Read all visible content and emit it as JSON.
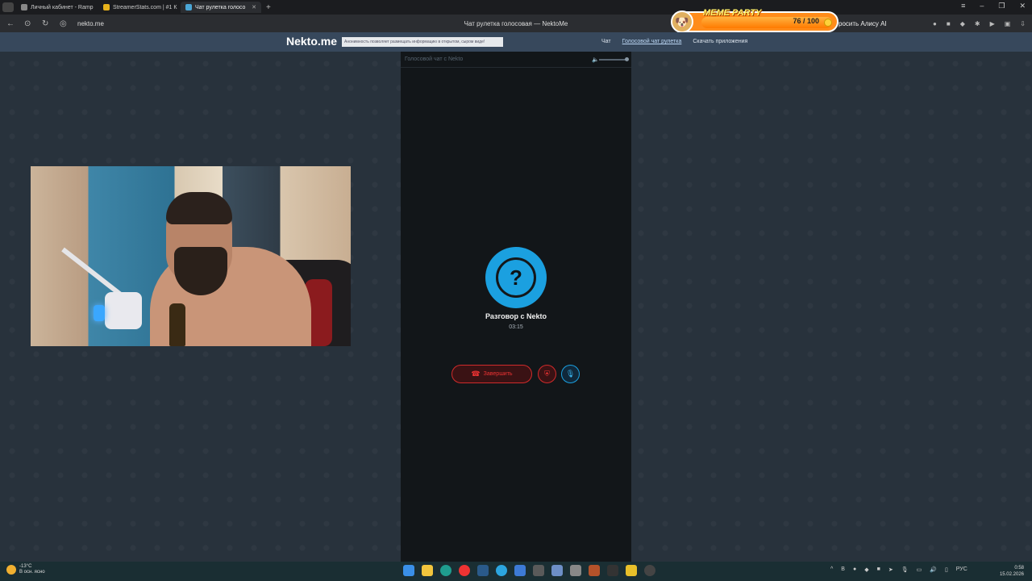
{
  "browser": {
    "tabs": [
      {
        "label": "Личный кабинет - Ramp",
        "active": false
      },
      {
        "label": "StreamerStats.com | #1 К",
        "active": false
      },
      {
        "label": "Чат рулетка голосо",
        "active": true
      }
    ],
    "url": "nekto.me",
    "page_title": "Чат рулетка голосовая — NektoMe",
    "ask_alice": "росить Алису AI"
  },
  "overlay": {
    "label": "MEME PARTY",
    "count": "76 / 100"
  },
  "site": {
    "logo": "Nekto.me",
    "notice": "Анонимность позволяет размещать информацию в открытом, сыром виде!",
    "nav": [
      "Чат",
      "Голосовой чат рулетка",
      "Скачать приложения"
    ]
  },
  "panel": {
    "title": "Голосовой чат с Nekto",
    "avatar_symbol": "?",
    "conversation": "Разговор с Nekto",
    "timer": "03:15",
    "end_label": "Завершить"
  },
  "taskbar": {
    "temp": "-13°C",
    "weather": "В осн. ясно",
    "lang": "РУС",
    "time": "0:58",
    "date": "15.02.2026"
  },
  "colors": {
    "accent_blue": "#1ba0e0",
    "danger_red": "#d02b2b",
    "header_bg": "#37485c"
  }
}
